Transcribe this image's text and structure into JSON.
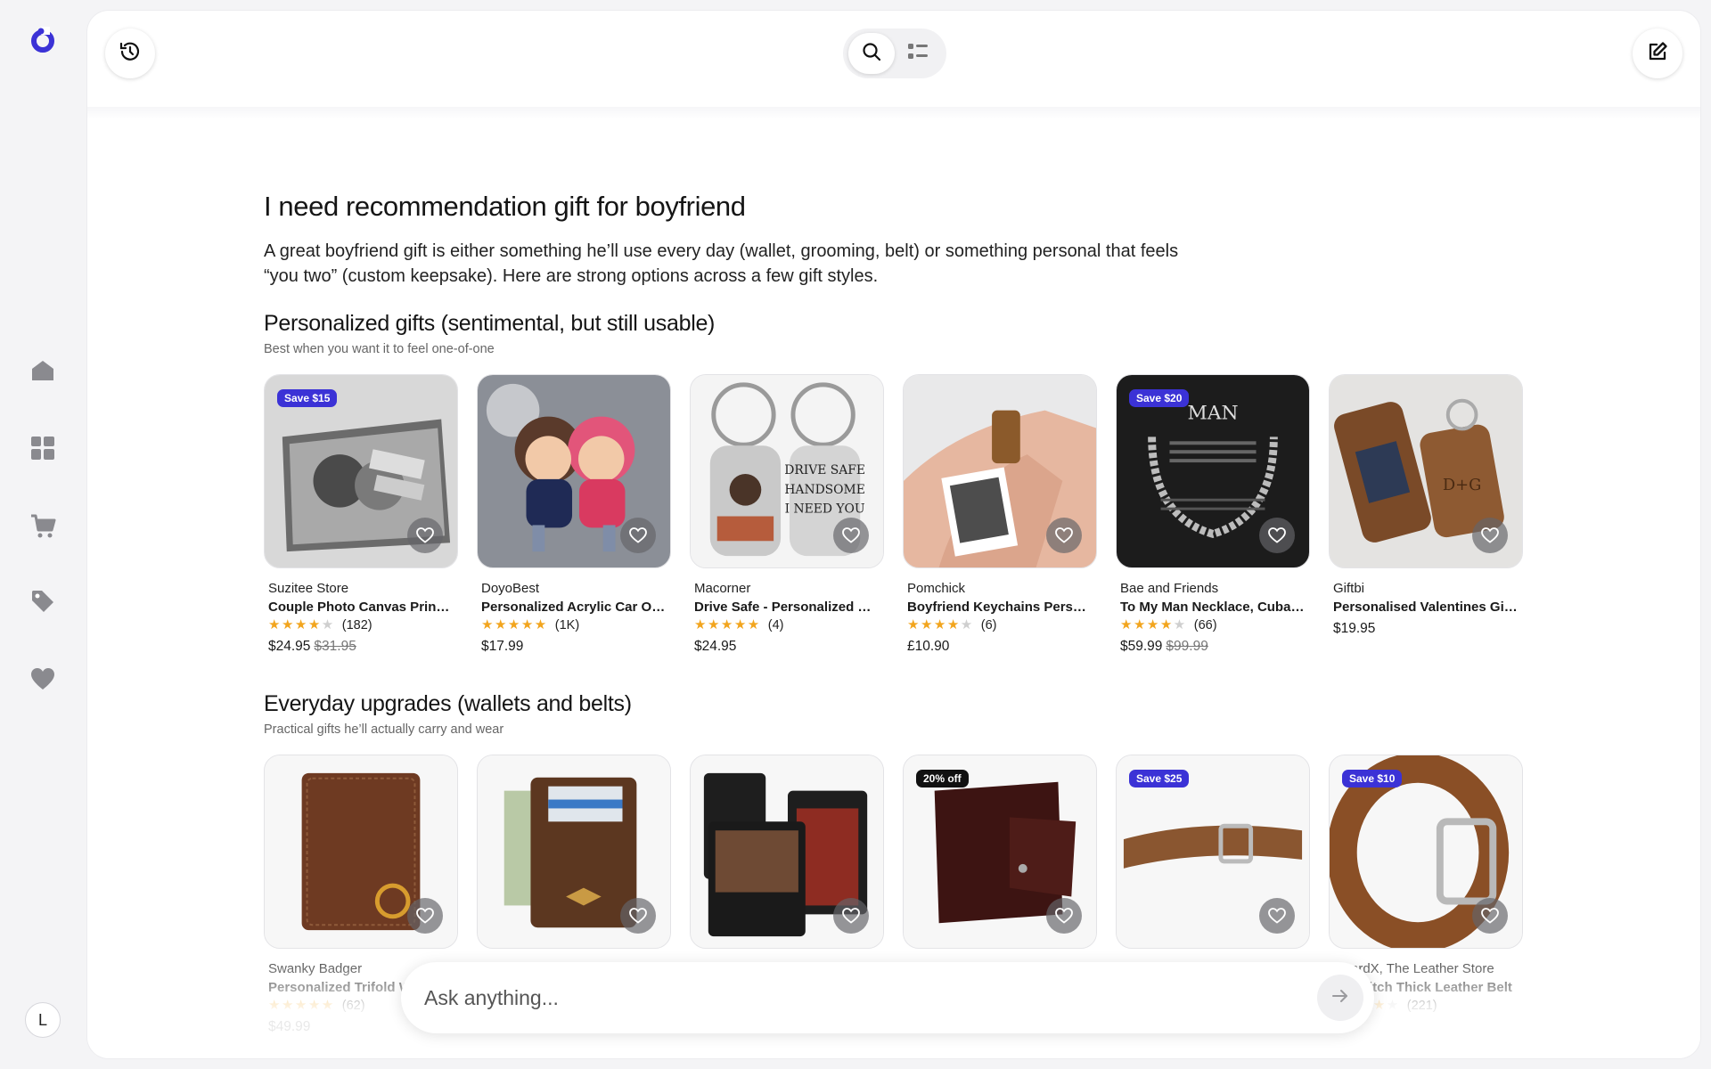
{
  "colors": {
    "accent": "#3b32d6",
    "star": "#f2a51e",
    "badge_dark": "#111111"
  },
  "rail": {
    "logo": "app-logo-icon",
    "items": [
      "home-icon",
      "grid-icon",
      "cart-icon",
      "tag-icon",
      "heart-icon"
    ],
    "avatar": "L"
  },
  "topbar": {
    "history_icon": "history-icon",
    "search_icon": "search-icon",
    "list_icon": "list-icon",
    "compose_icon": "compose-icon"
  },
  "page": {
    "title": "I need recommendation gift for boyfriend",
    "intro": "A great boyfriend gift is either something he’ll use every day (wallet, grooming, belt) or something personal that feels “you two” (custom keepsake). Here are strong options across a few gift styles."
  },
  "sections": [
    {
      "title": "Personalized gifts (sentimental, but still usable)",
      "subtitle": "Best when you want it to feel one-of-one",
      "products": [
        {
          "store": "Suzitee Store",
          "title": "Couple Photo Canvas Prints Personalized",
          "stars": 4.5,
          "reviews": "(182)",
          "price": "$24.95",
          "old_price": "$31.95",
          "badge": "Save $15"
        },
        {
          "store": "DoyoBest",
          "title": "Personalized Acrylic Car Ornament",
          "stars": 5,
          "reviews": "(1K)",
          "price": "$17.99",
          "old_price": "",
          "badge": ""
        },
        {
          "store": "Macorner",
          "title": "Drive Safe - Personalized Keychain",
          "stars": 5,
          "reviews": "(4)",
          "price": "$24.95",
          "old_price": "",
          "badge": ""
        },
        {
          "store": "Pomchick",
          "title": "Boyfriend Keychains Personalized",
          "stars": 4.5,
          "reviews": "(6)",
          "price": "£10.90",
          "old_price": "",
          "badge": ""
        },
        {
          "store": "Bae and Friends",
          "title": "To My Man Necklace, Cuban Chain",
          "stars": 4,
          "reviews": "(66)",
          "price": "$59.99",
          "old_price": "$99.99",
          "badge": "Save $20"
        },
        {
          "store": "Giftbi",
          "title": "Personalised Valentines Gift for Him",
          "stars": 0,
          "reviews": "",
          "price": "$19.95",
          "old_price": "",
          "badge": ""
        }
      ]
    },
    {
      "title": "Everyday upgrades (wallets and belts)",
      "subtitle": "Practical gifts he’ll actually carry and wear",
      "products": [
        {
          "store": "Swanky Badger",
          "title": "Personalized Trifold Wallet",
          "stars": 5,
          "reviews": "(62)",
          "price": "$49.99",
          "old_price": "",
          "badge": ""
        },
        {
          "store": "",
          "title": "",
          "stars": 0,
          "reviews": "",
          "price": "",
          "old_price": "",
          "badge": ""
        },
        {
          "store": "",
          "title": "",
          "stars": 0,
          "reviews": "",
          "price": "",
          "old_price": "",
          "badge": ""
        },
        {
          "store": "",
          "title": "",
          "stars": 0,
          "reviews": "",
          "price": "",
          "old_price": "",
          "badge": "20% off"
        },
        {
          "store": "",
          "title": "",
          "stars": 0,
          "reviews": "",
          "price": "",
          "old_price": "",
          "badge": "Save $25"
        },
        {
          "store": "...vardX, The Leather Store",
          "title": "...y Stitch Thick Leather Belt",
          "stars": 4.5,
          "reviews": "(221)",
          "price": "",
          "old_price": "",
          "badge": "Save $10"
        }
      ]
    }
  ],
  "ask": {
    "placeholder": "Ask anything...",
    "send_icon": "arrow-right-icon"
  }
}
